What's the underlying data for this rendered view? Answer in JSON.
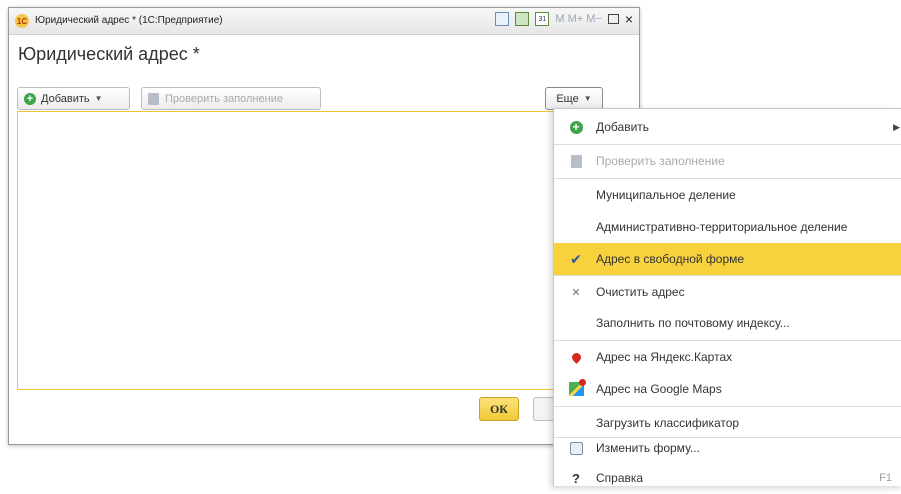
{
  "window": {
    "title": "Юридический адрес * (1С:Предприятие)",
    "logo_text": "1С",
    "memory_buttons": "M  M+  M−",
    "calendar_icon_text": "31"
  },
  "form": {
    "heading": "Юридический адрес *",
    "toolbar": {
      "add_label": "Добавить",
      "check_label": "Проверить заполнение",
      "more_label": "Еще"
    },
    "ok_label": "ОК"
  },
  "menu": {
    "items": [
      {
        "label": "Добавить",
        "icon": "plus-circle-icon",
        "submenu": true
      },
      {
        "label": "Проверить заполнение",
        "icon": "check-fill-icon",
        "disabled": true
      },
      {
        "label": "Муниципальное деление"
      },
      {
        "label": "Административно-территориальное деление"
      },
      {
        "label": "Адрес в свободной форме",
        "icon": "checkmark-icon",
        "checked": true
      },
      {
        "label": "Очистить адрес",
        "icon": "clear-icon"
      },
      {
        "label": "Заполнить по почтовому индексу..."
      },
      {
        "label": "Адрес на Яндекс.Картах",
        "icon": "yandex-pin-icon"
      },
      {
        "label": "Адрес на Google Maps",
        "icon": "google-maps-icon"
      },
      {
        "label": "Загрузить классификатор"
      },
      {
        "label": "Изменить форму...",
        "icon": "form-settings-icon"
      },
      {
        "label": "Справка",
        "icon": "help-icon",
        "shortcut": "F1"
      }
    ]
  },
  "colors": {
    "accent_yellow": "#f7d23d",
    "add_green": "#3ea34a",
    "field_border": "#f0c43a"
  }
}
